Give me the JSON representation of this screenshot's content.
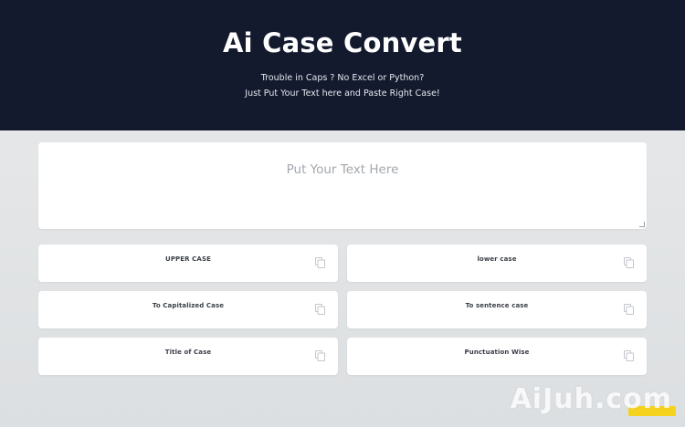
{
  "header": {
    "title": "Ai Case Convert",
    "subtitle_line1": "Trouble in Caps ? No Excel or Python?",
    "subtitle_line2": "Just Put Your Text here and Paste Right Case!"
  },
  "input": {
    "placeholder": "Put Your Text Here"
  },
  "buttons": [
    {
      "label": "UPPER CASE",
      "icon": "copy-icon"
    },
    {
      "label": "lower case",
      "icon": "copy-icon"
    },
    {
      "label": "To Capitalized Case",
      "icon": "copy-icon"
    },
    {
      "label": "To sentence case",
      "icon": "copy-icon"
    },
    {
      "label": "Title of Case",
      "icon": "copy-icon"
    },
    {
      "label": "Punctuation Wise",
      "icon": "copy-icon"
    }
  ],
  "watermark": "AiJuh.com",
  "colors": {
    "hero_bg": "#131a2e",
    "page_bg": "#e3e5e7",
    "card_bg": "#ffffff",
    "badge": "#f4d21e"
  }
}
